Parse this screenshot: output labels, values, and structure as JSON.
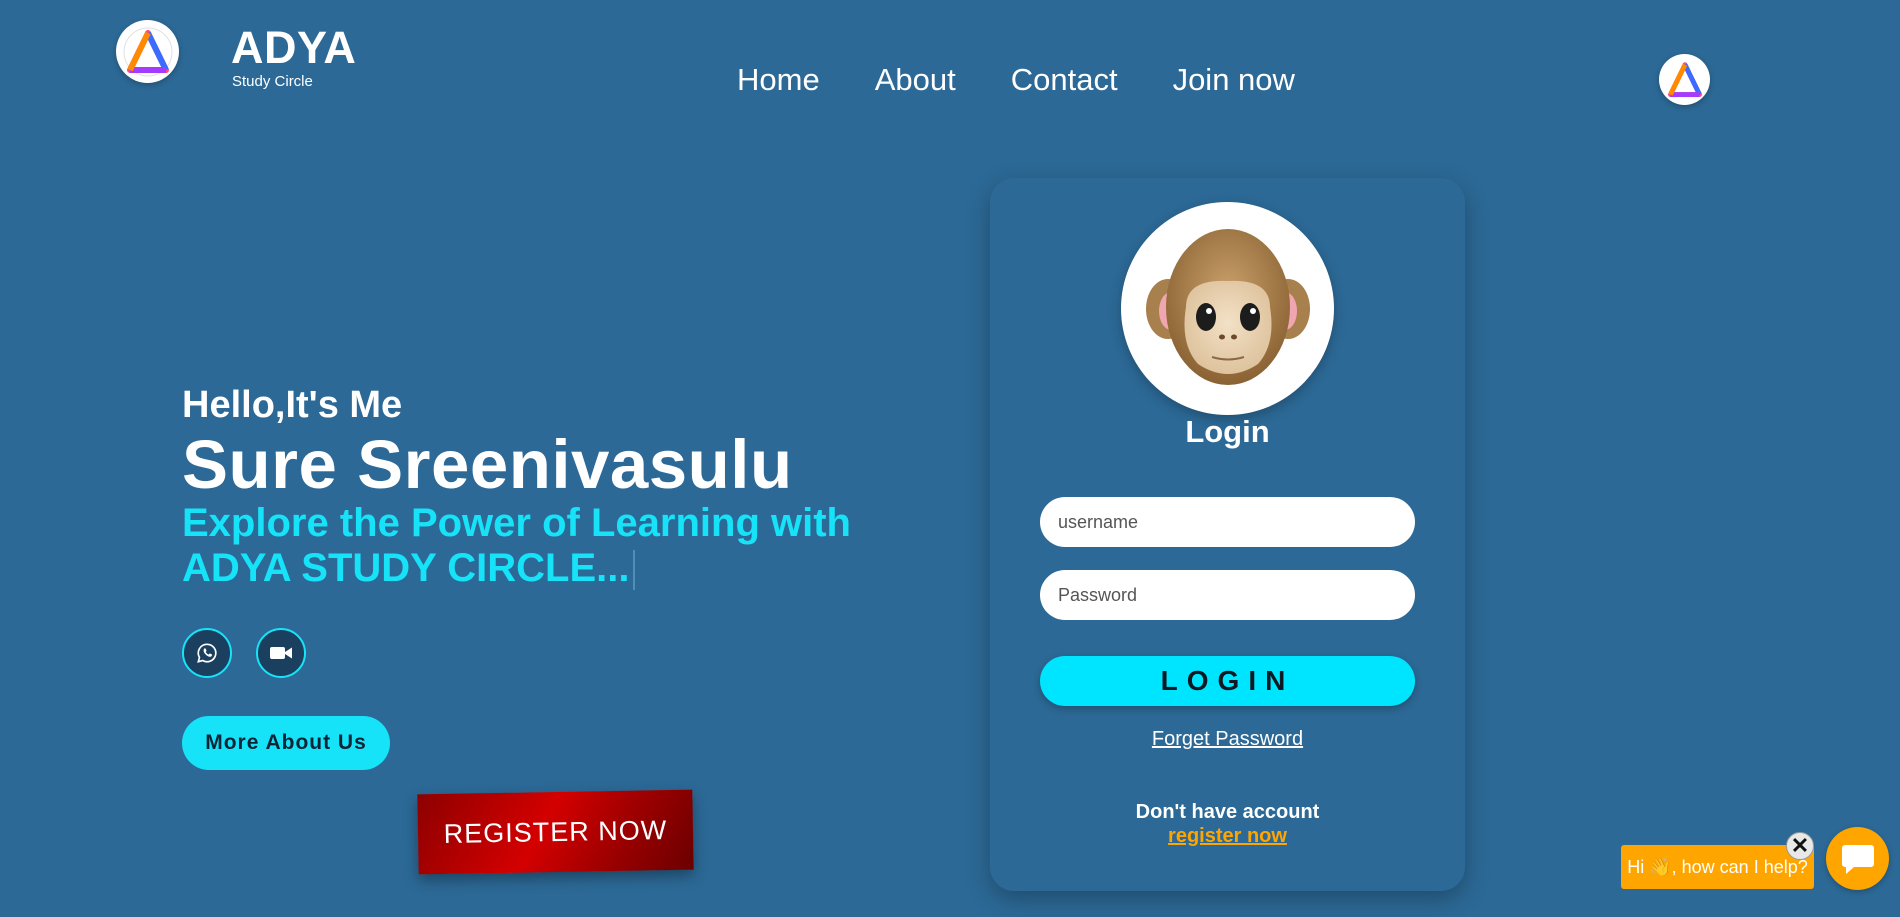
{
  "brand": {
    "title": "ADYA",
    "subtitle": "Study Circle",
    "logo_icon": "adya-logo-icon"
  },
  "nav": {
    "items": [
      {
        "label": "Home"
      },
      {
        "label": "About"
      },
      {
        "label": "Contact"
      },
      {
        "label": "Join now"
      }
    ]
  },
  "hero": {
    "greeting": "Hello,It's Me",
    "name": "Sure Sreenivasulu",
    "tagline": "Explore the Power of Learning with ADYA STUDY CIRCLE...",
    "social": [
      {
        "icon": "whatsapp-icon"
      },
      {
        "icon": "video-camera-icon"
      }
    ],
    "more_label": "More About Us",
    "register_label": "REGISTER NOW"
  },
  "login": {
    "avatar_icon": "monkey-face-icon",
    "title": "Login",
    "username_placeholder": "username",
    "password_placeholder": "Password",
    "button_label": "LOGIN",
    "forget_label": "Forget Password",
    "no_account_label": "Don't have account",
    "register_link": "register now"
  },
  "chat": {
    "greeting": "Hi 👋, how can I help?",
    "close_label": "✕",
    "fab_icon": "chat-bubble-icon"
  },
  "colors": {
    "background": "#2c6996",
    "accent": "#16e3f8",
    "login_button": "#00e5ff",
    "register_red": "#c00000",
    "orange": "#ffa500"
  }
}
